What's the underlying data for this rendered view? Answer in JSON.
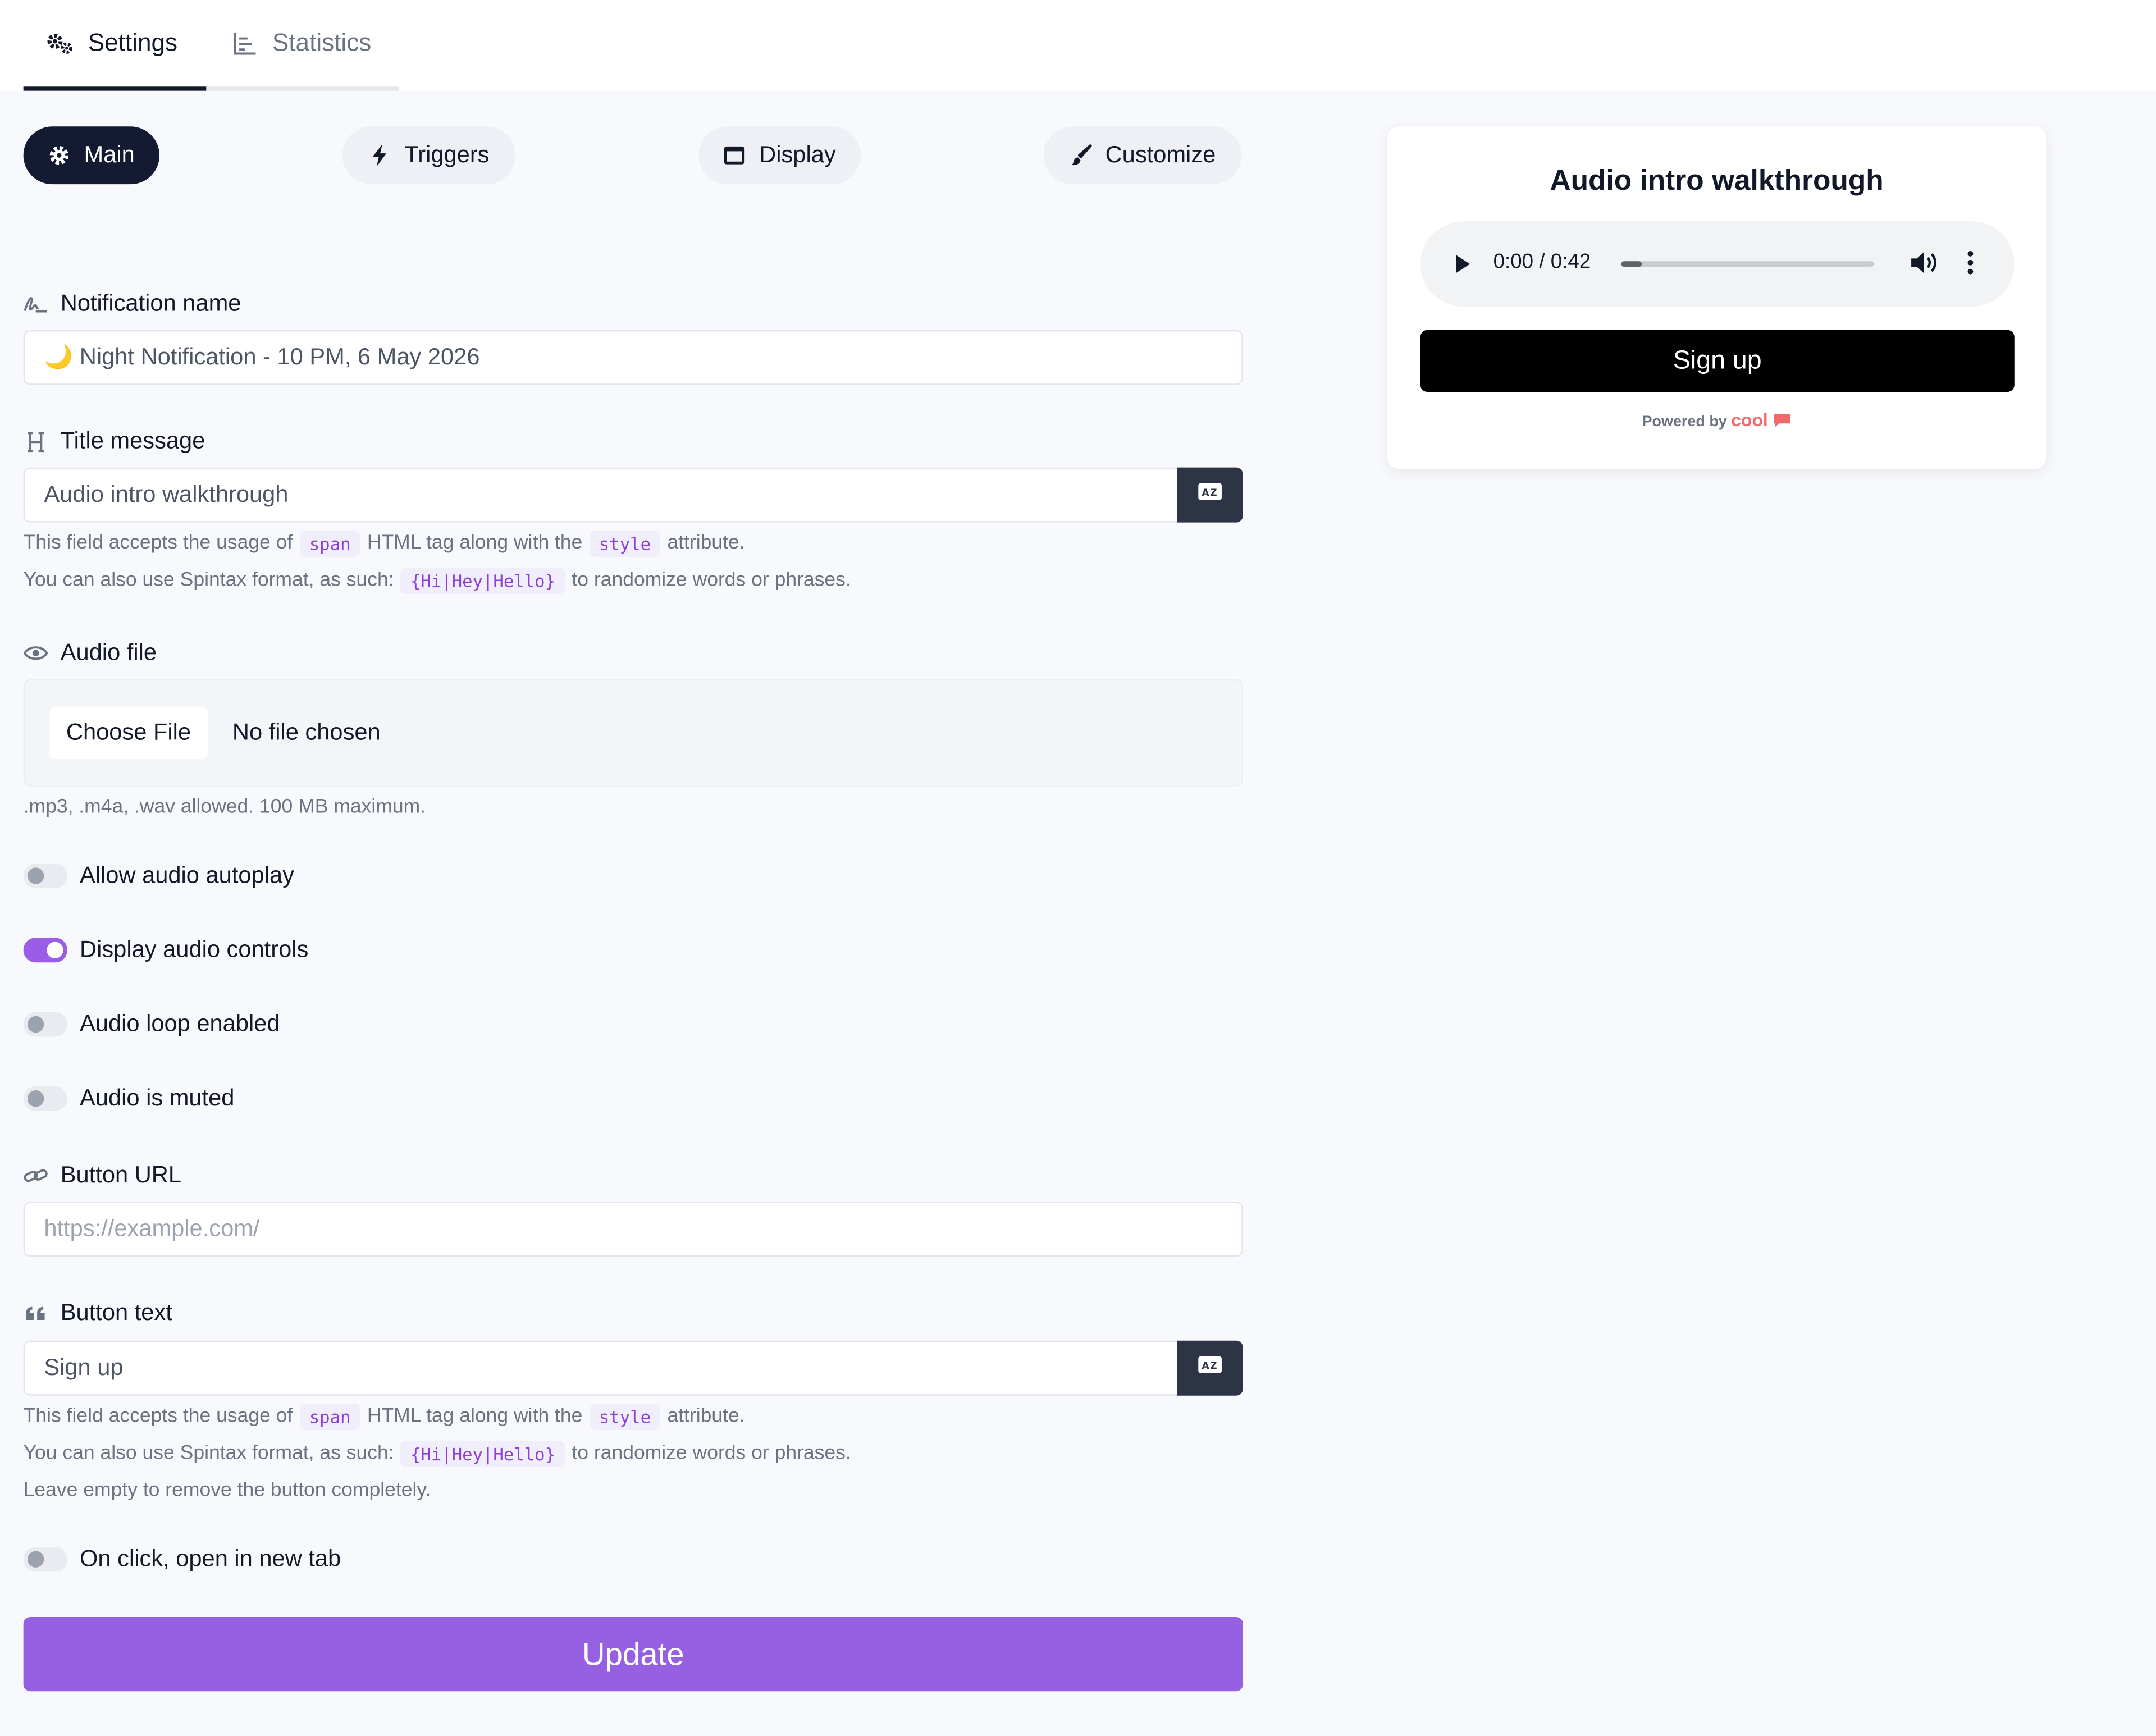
{
  "top_tabs": [
    {
      "label": "Settings",
      "icon": "gears-icon",
      "active": true
    },
    {
      "label": "Statistics",
      "icon": "bar-chart-icon",
      "active": false
    }
  ],
  "sub_tabs": [
    {
      "label": "Main",
      "icon": "cog-icon",
      "active": true
    },
    {
      "label": "Triggers",
      "icon": "bolt-icon",
      "active": false
    },
    {
      "label": "Display",
      "icon": "window-icon",
      "active": false
    },
    {
      "label": "Customize",
      "icon": "paintbrush-icon",
      "active": false
    }
  ],
  "form": {
    "notification_name": {
      "label": "Notification name",
      "value": "🌙 Night Notification - 10 PM, 6 May 2026"
    },
    "title_message": {
      "label": "Title message",
      "value": "Audio intro walkthrough"
    },
    "help": {
      "accepts_prefix": "This field accepts the usage of",
      "span_tag": "span",
      "accepts_middle": "HTML tag along with the",
      "style_attr": "style",
      "accepts_suffix": "attribute.",
      "spintax_prefix": "You can also use Spintax format, as such:",
      "spintax_example": "{Hi|Hey|Hello}",
      "spintax_suffix": "to randomize words or phrases.",
      "leave_empty": "Leave empty to remove the button completely."
    },
    "audio_file": {
      "label": "Audio file",
      "choose_label": "Choose File",
      "no_file": "No file chosen",
      "hint": ".mp3, .m4a, .wav allowed. 100 MB maximum."
    },
    "toggles": {
      "autoplay": {
        "label": "Allow audio autoplay",
        "on": false
      },
      "controls": {
        "label": "Display audio controls",
        "on": true
      },
      "loop": {
        "label": "Audio loop enabled",
        "on": false
      },
      "muted": {
        "label": "Audio is muted",
        "on": false
      },
      "new_tab": {
        "label": "On click, open in new tab",
        "on": false
      }
    },
    "button_url": {
      "label": "Button URL",
      "placeholder": "https://example.com/"
    },
    "button_text": {
      "label": "Button text",
      "value": "Sign up"
    },
    "update_label": "Update"
  },
  "preview": {
    "title": "Audio intro walkthrough",
    "time": "0:00 / 0:42",
    "progress_fraction": 0.08,
    "button_label": "Sign up",
    "powered_by": "Powered by",
    "brand": "cool"
  },
  "colors": {
    "accent": "#9561e2",
    "toggle_on": "#9b5de5",
    "dark_pill": "#151a33",
    "code_text": "#8b3fd6",
    "brand": "#ef6b6b"
  }
}
